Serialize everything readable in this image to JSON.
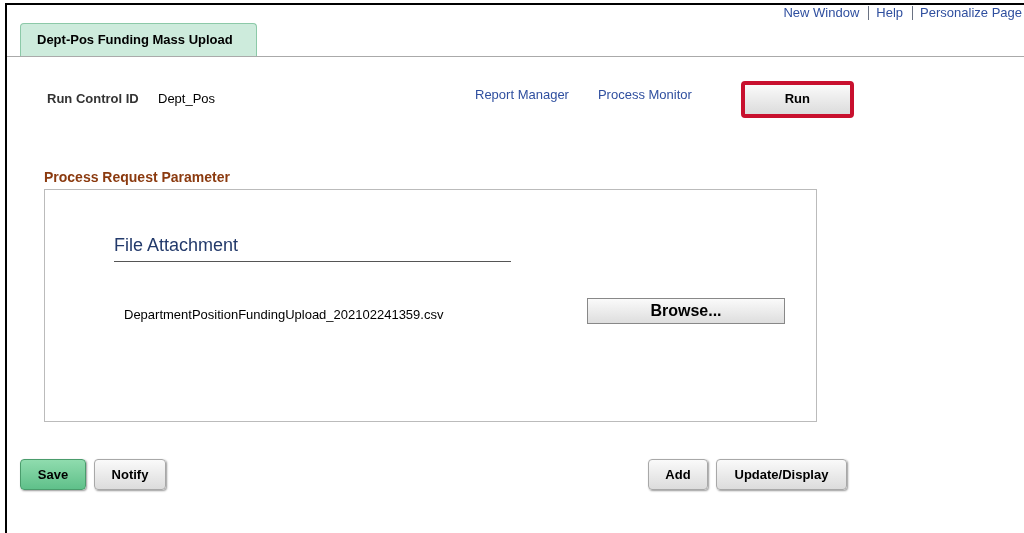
{
  "header_links": [
    "New Window",
    "Help",
    "Personalize Page"
  ],
  "tabs": [
    {
      "label": "Dept-Pos Funding Mass Upload",
      "selected": true
    }
  ],
  "run_control": {
    "label": "Run Control ID",
    "value": "Dept_Pos"
  },
  "links": [
    "Report Manager",
    "Process Monitor"
  ],
  "run_button": {
    "label": "Run",
    "highlighted": true
  },
  "section": {
    "title": "Process Request Parameter",
    "group_title": "File Attachment",
    "file_name": "DepartmentPositionFundingUpload_202102241359.csv",
    "browse_button": "Browse..."
  },
  "footer_left": [
    {
      "label": "Save",
      "kind": "primary"
    },
    {
      "label": "Notify",
      "kind": "secondary"
    }
  ],
  "footer_right": [
    {
      "label": "Add",
      "kind": "secondary"
    },
    {
      "label": "Update/Display",
      "kind": "secondary"
    }
  ]
}
